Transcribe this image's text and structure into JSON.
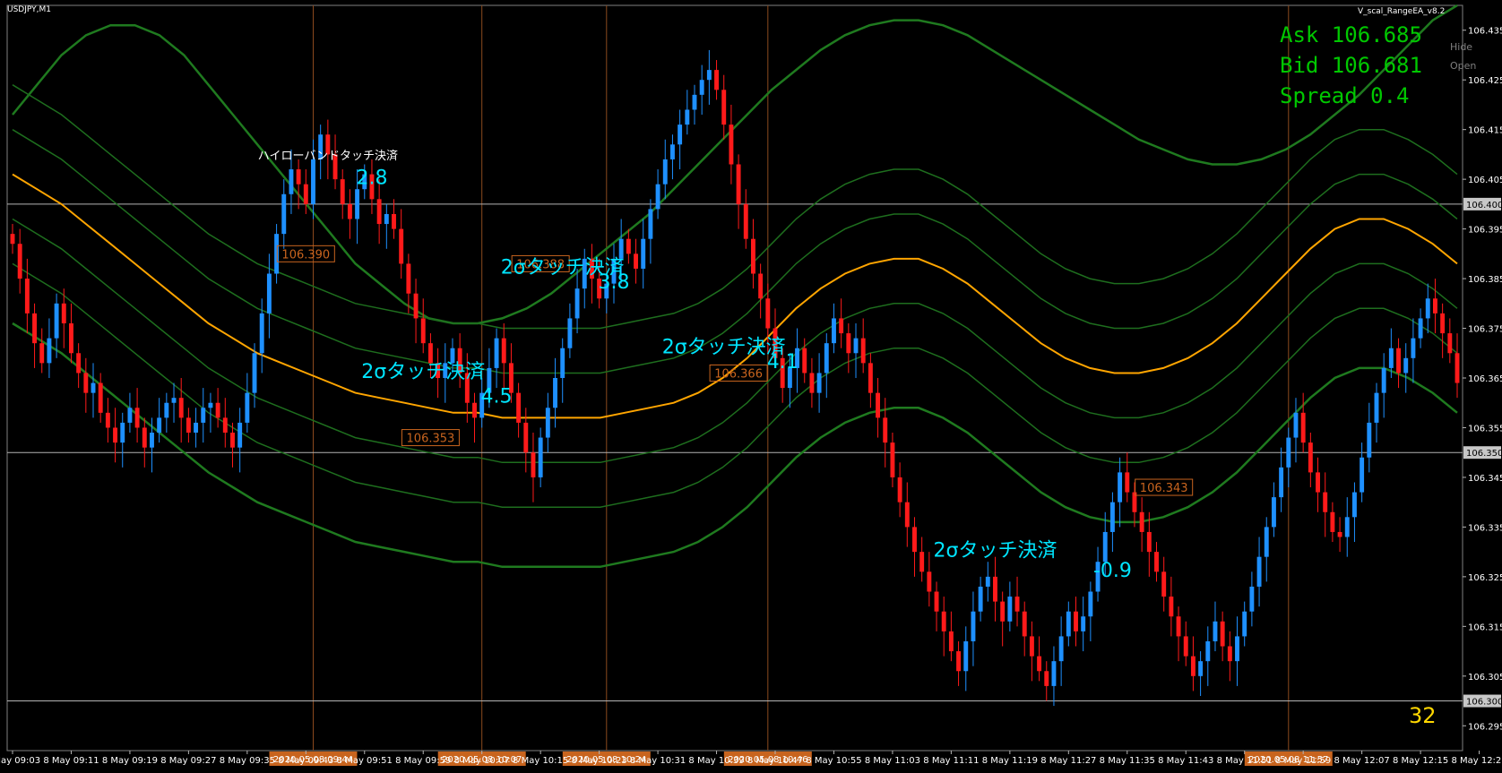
{
  "window": {
    "symbol": "USDJPY,M1",
    "ea_name": "V_scal_RangeEA_v8.2",
    "buttons": [
      "Hide",
      "Open"
    ],
    "bar_count": "32"
  },
  "quote": {
    "ask": "Ask 106.685",
    "bid": "Bid 106.681",
    "spread": "Spread 0.4"
  },
  "chart_data": {
    "type": "candlestick",
    "symbol": "USDJPY",
    "timeframe": "M1",
    "ylim": [
      106.29,
      106.44
    ],
    "y_ticks": [
      "106.435",
      "106.425",
      "106.415",
      "106.405",
      "106.395",
      "106.385",
      "106.375",
      "106.365",
      "106.355",
      "106.345",
      "106.335",
      "106.325",
      "106.315",
      "106.305",
      "106.295"
    ],
    "highlighted_prices": [
      "106.400",
      "106.350",
      "106.300"
    ],
    "x_ticks": [
      {
        "label": "8 May 09:03",
        "pos": 0
      },
      {
        "label": "8 May 09:11",
        "pos": 8
      },
      {
        "label": "8 May 09:19",
        "pos": 16
      },
      {
        "label": "8 May 09:27",
        "pos": 24
      },
      {
        "label": "8 May 09:35",
        "pos": 32
      },
      {
        "label": "8 May 09:43",
        "pos": 40
      },
      {
        "label": "8 May 09:51",
        "pos": 48
      },
      {
        "label": "8 May 09:59",
        "pos": 56
      },
      {
        "label": "8 May 10:07",
        "pos": 64
      },
      {
        "label": "8 May 10:15",
        "pos": 72
      },
      {
        "label": "8 May 10:23",
        "pos": 80
      },
      {
        "label": "8 May 10:31",
        "pos": 88
      },
      {
        "label": "8 May 10:39",
        "pos": 96
      },
      {
        "label": "8 May 10:47",
        "pos": 104
      },
      {
        "label": "8 May 10:55",
        "pos": 112
      },
      {
        "label": "8 May 11:03",
        "pos": 120
      },
      {
        "label": "8 May 11:11",
        "pos": 128
      },
      {
        "label": "8 May 11:19",
        "pos": 136
      },
      {
        "label": "8 May 11:27",
        "pos": 144
      },
      {
        "label": "8 May 11:35",
        "pos": 152
      },
      {
        "label": "8 May 11:43",
        "pos": 160
      },
      {
        "label": "8 May 11:51",
        "pos": 168
      },
      {
        "label": "8 May 11:59",
        "pos": 176
      },
      {
        "label": "8 May 12:07",
        "pos": 184
      },
      {
        "label": "8 May 12:15",
        "pos": 192
      },
      {
        "label": "8 May 12:23",
        "pos": 200
      }
    ],
    "session_markers": [
      {
        "label": "2020.05.08 09:44",
        "pos": 41
      },
      {
        "label": "2020.05.08 10:07",
        "pos": 64
      },
      {
        "label": "2020.05.08 10:24",
        "pos": 81
      },
      {
        "label": "2020.05.08 10:46",
        "pos": 103
      },
      {
        "label": "2020.05.08 11:57",
        "pos": 174
      }
    ],
    "closes": [
      106.392,
      106.385,
      106.378,
      106.372,
      106.368,
      106.373,
      106.38,
      106.376,
      106.37,
      106.366,
      106.362,
      106.364,
      106.358,
      106.355,
      106.352,
      106.356,
      106.359,
      106.355,
      106.351,
      106.354,
      106.357,
      106.36,
      106.361,
      106.357,
      106.354,
      106.356,
      106.359,
      106.36,
      106.357,
      106.354,
      106.351,
      106.356,
      106.362,
      106.37,
      106.378,
      106.386,
      106.394,
      106.402,
      106.407,
      106.404,
      106.4,
      106.409,
      106.414,
      106.41,
      106.405,
      106.4,
      106.397,
      106.403,
      106.406,
      106.401,
      106.396,
      106.398,
      106.395,
      106.388,
      106.382,
      106.377,
      106.372,
      106.368,
      106.365,
      106.368,
      106.371,
      106.366,
      106.36,
      106.357,
      106.362,
      106.367,
      106.373,
      106.368,
      106.362,
      106.356,
      106.35,
      106.345,
      106.353,
      106.359,
      106.365,
      106.371,
      106.377,
      106.383,
      106.389,
      106.385,
      106.381,
      106.384,
      106.389,
      106.393,
      106.39,
      106.387,
      106.393,
      106.399,
      106.404,
      106.409,
      106.412,
      106.416,
      106.419,
      106.422,
      106.425,
      106.427,
      106.423,
      106.416,
      106.408,
      106.4,
      106.393,
      106.386,
      106.381,
      106.375,
      106.369,
      106.363,
      106.367,
      106.371,
      106.366,
      106.362,
      106.366,
      106.372,
      106.377,
      106.374,
      106.37,
      106.373,
      106.368,
      106.362,
      106.357,
      106.352,
      106.345,
      106.34,
      106.335,
      106.33,
      106.326,
      106.322,
      106.318,
      106.314,
      106.31,
      106.306,
      106.312,
      106.318,
      106.323,
      106.325,
      106.32,
      106.316,
      106.321,
      106.318,
      106.313,
      106.309,
      106.306,
      106.303,
      106.308,
      106.313,
      106.318,
      106.314,
      106.317,
      106.322,
      106.328,
      106.334,
      106.34,
      106.346,
      106.342,
      106.338,
      106.334,
      106.33,
      106.326,
      106.321,
      106.317,
      106.313,
      106.309,
      106.305,
      106.308,
      106.312,
      106.316,
      106.311,
      106.308,
      106.313,
      106.318,
      106.323,
      106.329,
      106.335,
      106.341,
      106.347,
      106.353,
      106.358,
      106.352,
      106.346,
      106.342,
      106.338,
      106.334,
      106.333,
      106.337,
      106.342,
      106.349,
      106.356,
      106.362,
      106.367,
      106.371,
      106.366,
      106.369,
      106.373,
      106.377,
      106.381,
      106.378,
      106.374,
      106.37,
      106.364
    ],
    "indicators": {
      "bb_upper_3": [
        106.418,
        106.424,
        106.43,
        106.434,
        106.436,
        106.436,
        106.434,
        106.43,
        106.424,
        106.418,
        106.412,
        106.406,
        106.4,
        106.394,
        106.388,
        106.384,
        106.38,
        106.377,
        106.376,
        106.376,
        106.377,
        106.379,
        106.382,
        106.386,
        106.39,
        106.394,
        106.398,
        106.403,
        106.408,
        106.413,
        106.418,
        106.423,
        106.427,
        106.431,
        106.434,
        106.436,
        106.437,
        106.437,
        106.436,
        106.434,
        106.431,
        106.428,
        106.425,
        106.422,
        106.419,
        106.416,
        106.413,
        106.411,
        106.409,
        106.408,
        106.408,
        106.409,
        106.411,
        106.414,
        106.418,
        106.422,
        106.427,
        106.432,
        106.437,
        106.44
      ],
      "ma": [
        106.406,
        106.403,
        106.4,
        106.396,
        106.392,
        106.388,
        106.384,
        106.38,
        106.376,
        106.373,
        106.37,
        106.368,
        106.366,
        106.364,
        106.362,
        106.361,
        106.36,
        106.359,
        106.358,
        106.358,
        106.357,
        106.357,
        106.357,
        106.357,
        106.357,
        106.358,
        106.359,
        106.36,
        106.362,
        106.365,
        106.369,
        106.374,
        106.379,
        106.383,
        106.386,
        106.388,
        106.389,
        106.389,
        106.387,
        106.384,
        106.38,
        106.376,
        106.372,
        106.369,
        106.367,
        106.366,
        106.366,
        106.367,
        106.369,
        106.372,
        106.376,
        106.381,
        106.386,
        106.391,
        106.395,
        106.397,
        106.397,
        106.395,
        106.392,
        106.388
      ]
    },
    "annotations": [
      {
        "text": "ハイローバンドタッチ決済",
        "pos": 43,
        "price": 106.409
      },
      {
        "text": "2.8",
        "pos": 49,
        "price": 106.404
      },
      {
        "text": "2σタッチ決済",
        "pos": 75,
        "price": 106.386
      },
      {
        "text": "3.8",
        "pos": 82,
        "price": 106.383
      },
      {
        "text": "2σタッチ決済",
        "pos": 56,
        "price": 106.365
      },
      {
        "text": "4.5",
        "pos": 66,
        "price": 106.36
      },
      {
        "text": "2σタッチ決済",
        "pos": 97,
        "price": 106.37
      },
      {
        "text": "4.1",
        "pos": 105,
        "price": 106.367
      },
      {
        "text": "2σタッチ決済",
        "pos": 134,
        "price": 106.329
      },
      {
        "text": "-0.9",
        "pos": 150,
        "price": 106.325
      }
    ],
    "price_labels": [
      "106.390",
      "106.388",
      "106.366",
      "106.353",
      "106.343"
    ]
  }
}
